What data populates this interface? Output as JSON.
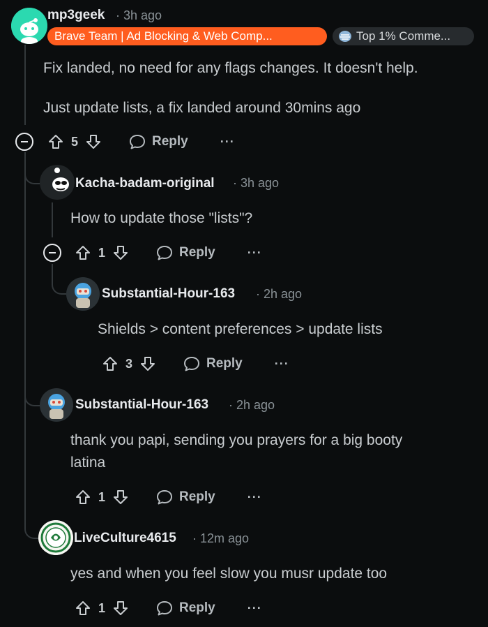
{
  "colors": {
    "background": "#0b0d0e",
    "flair_orange": "#ff5d1f",
    "flair_dark": "#272b2e",
    "thread": "#33383b"
  },
  "comments": [
    {
      "username": "mp3geek",
      "time": "3h ago",
      "flair": "Brave Team | Ad Blocking & Web Comp...",
      "badge": "Top 1% Comme...",
      "body_lines": [
        "Fix landed, no need for any flags changes. It doesn't help.",
        "Just update lists, a fix landed around 30mins ago"
      ],
      "votes": "5",
      "reply_label": "Reply",
      "more": "···"
    },
    {
      "username": "Kacha-badam-original",
      "time": "3h ago",
      "body_lines": [
        "How to update those \"lists\"?"
      ],
      "votes": "1",
      "reply_label": "Reply",
      "more": "···"
    },
    {
      "username": "Substantial-Hour-163",
      "time": "2h ago",
      "body_lines": [
        "Shields > content preferences > update lists"
      ],
      "votes": "3",
      "reply_label": "Reply",
      "more": "···"
    },
    {
      "username": "Substantial-Hour-163",
      "time": "2h ago",
      "body_lines": [
        "thank you papi, sending you prayers for a big booty",
        "latina"
      ],
      "votes": "1",
      "reply_label": "Reply",
      "more": "···"
    },
    {
      "username": "LiveCulture4615",
      "time": "12m ago",
      "body_lines": [
        "yes and when you feel slow you musr update too"
      ],
      "votes": "1",
      "reply_label": "Reply",
      "more": "···"
    }
  ]
}
